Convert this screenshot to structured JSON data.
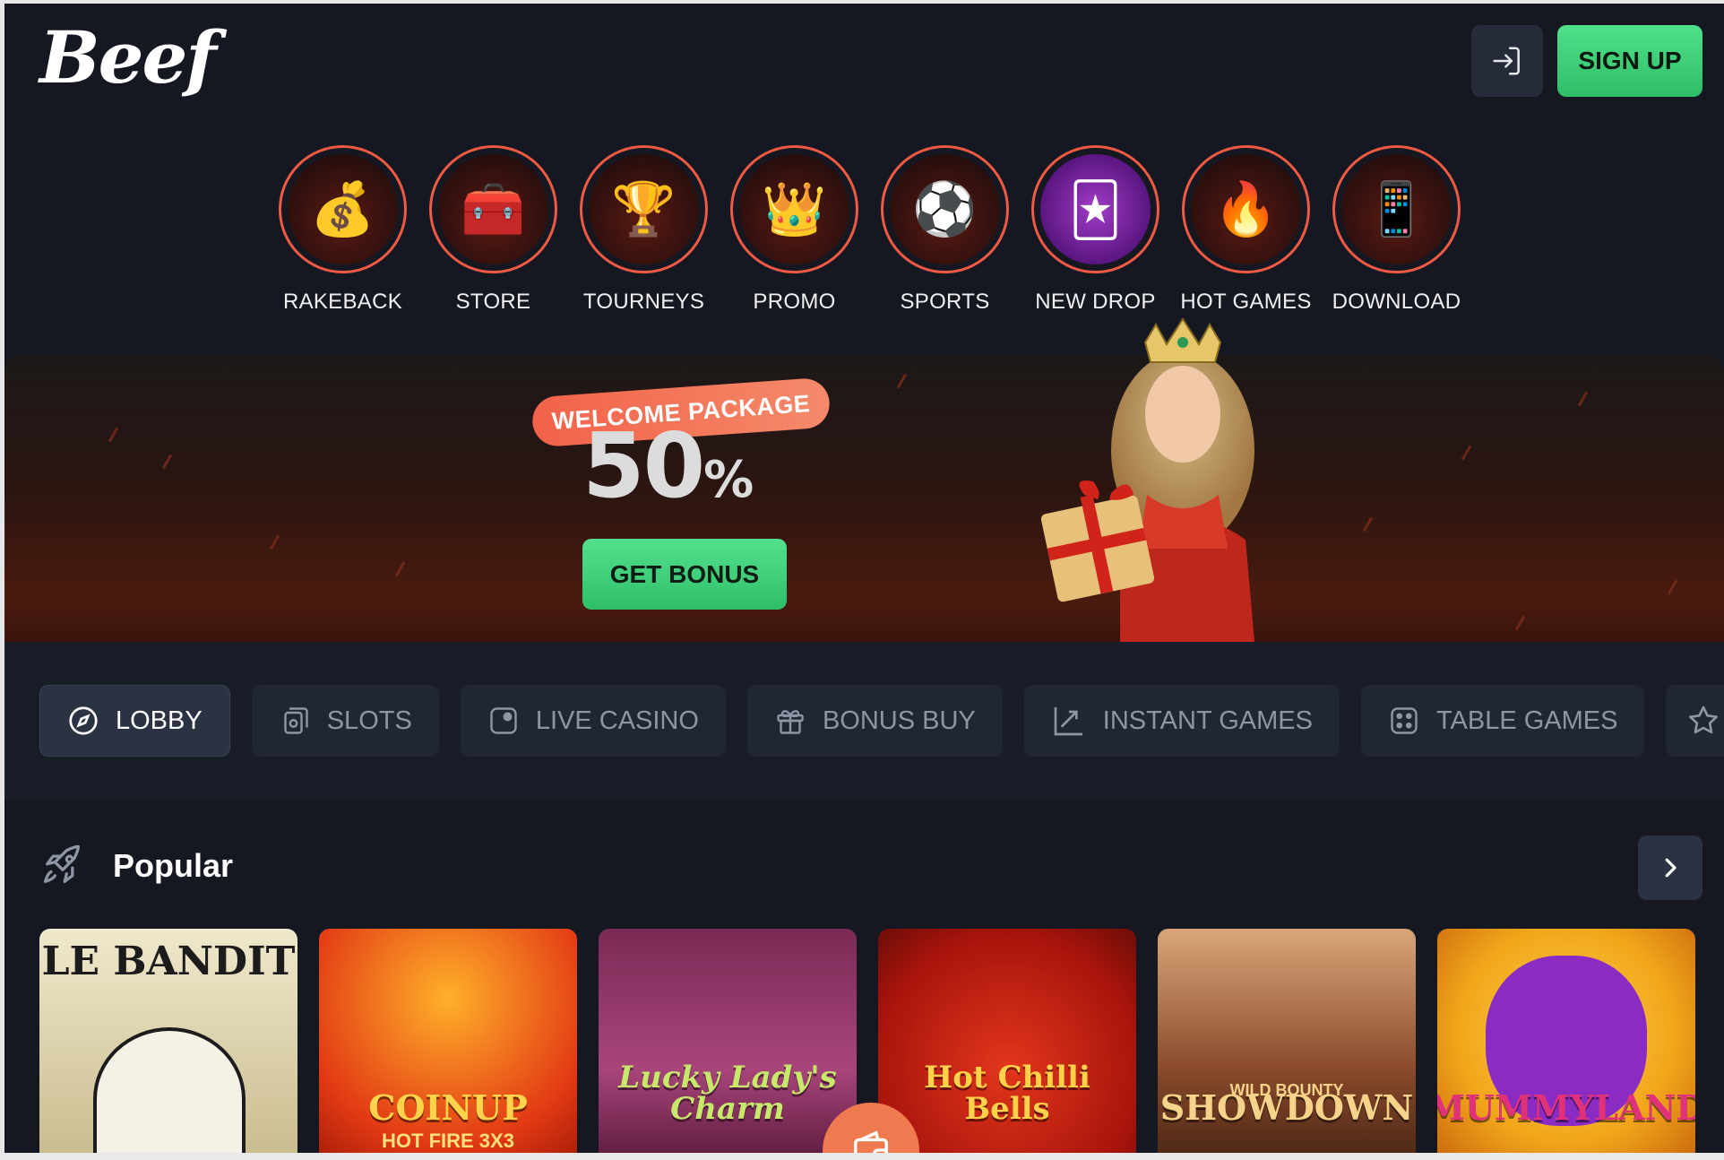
{
  "header": {
    "logo_text": "Beef",
    "login_icon": "login-arrow-icon",
    "signup_label": "SIGN UP"
  },
  "stories": [
    {
      "label": "RAKEBACK",
      "icon": "treasure-chest-icon",
      "glyph": "💰"
    },
    {
      "label": "STORE",
      "icon": "store-chest-icon",
      "glyph": "🧰"
    },
    {
      "label": "TOURNEYS",
      "icon": "trophy-icon",
      "glyph": "🏆"
    },
    {
      "label": "PROMO",
      "icon": "crown-icon",
      "glyph": "👑"
    },
    {
      "label": "SPORTS",
      "icon": "soccer-ball-icon",
      "glyph": "⚽"
    },
    {
      "label": "NEW DROP",
      "icon": "joker-game-icon",
      "glyph": "🃏"
    },
    {
      "label": "HOT GAMES",
      "icon": "flame-icon",
      "glyph": "🔥"
    },
    {
      "label": "DOWNLOAD",
      "icon": "phone-app-icon",
      "glyph": "📱"
    }
  ],
  "banner": {
    "tag": "WELCOME PACKAGE",
    "percent_value": "50",
    "percent_symbol": "%",
    "cta_label": "GET BONUS"
  },
  "tabs": [
    {
      "label": "LOBBY",
      "icon": "compass-icon",
      "active": true
    },
    {
      "label": "SLOTS",
      "icon": "slots-cards-icon",
      "active": false
    },
    {
      "label": "LIVE CASINO",
      "icon": "live-casino-icon",
      "active": false
    },
    {
      "label": "BONUS BUY",
      "icon": "gift-icon",
      "active": false
    },
    {
      "label": "INSTANT GAMES",
      "icon": "chart-arrow-icon",
      "active": false
    },
    {
      "label": "TABLE GAMES",
      "icon": "dice-icon",
      "active": false
    }
  ],
  "popular": {
    "title": "Popular",
    "icon": "rocket-icon",
    "next_icon": "chevron-right-icon"
  },
  "games": [
    {
      "title": "LE BANDIT",
      "sub": "",
      "bg": "#e9e3c8",
      "fg": "#1c1c1c"
    },
    {
      "title": "COINUP",
      "sub": "HOT FIRE 3X3",
      "bg": "#e23a14",
      "fg": "#ffd34a"
    },
    {
      "title": "Lucky Lady's Charm",
      "sub": "",
      "bg": "#8a2f5c",
      "fg": "#c7e86a"
    },
    {
      "title": "Hot Chilli Bells",
      "sub": "",
      "bg": "#b5180f",
      "fg": "#ffd24a"
    },
    {
      "title": "SHOWDOWN",
      "sub": "WILD BOUNTY",
      "bg": "#b0653a",
      "fg": "#f6d38a"
    },
    {
      "title": "MUMMYLAND",
      "sub": "",
      "bg": "#f1a51a",
      "fg": "#e0327a"
    }
  ],
  "colors": {
    "accent_green": "#3fd27a",
    "accent_orange": "#ef5a45",
    "background": "#151821"
  }
}
